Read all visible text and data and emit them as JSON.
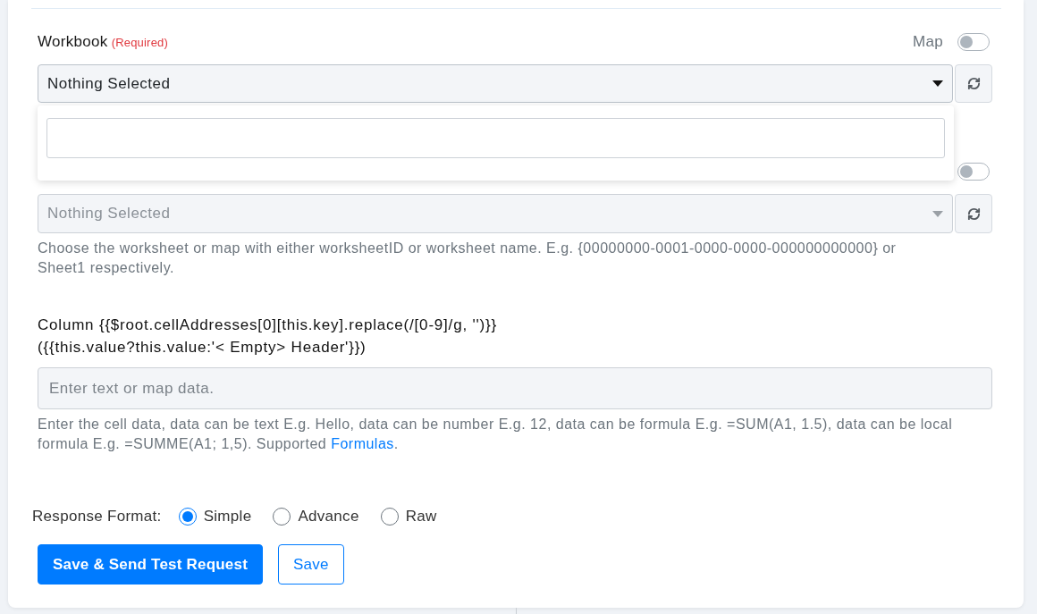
{
  "form": {
    "fields": [
      {
        "kind": "select",
        "label": "Workbook",
        "required_note": "(Required)",
        "map_label": "Map",
        "map_on": false,
        "value": "Nothing Selected",
        "disabled": false,
        "expanded": true
      },
      {
        "kind": "select",
        "map_on": false,
        "value": "Nothing Selected",
        "disabled": true,
        "expanded": false,
        "help": [
          {
            "kind": "text",
            "text": "Choose the worksheet or map with either worksheetID or worksheet name. E.g. {00000000-0001-0000-0000-000000000000} or Sheet1 respectively."
          }
        ]
      },
      {
        "kind": "text",
        "label_lines": [
          "Column {{$root.cellAddresses[0][this.key].replace(/[0-9]/g, '')}}",
          "({{this.value?this.value:'< Empty> Header'}})"
        ],
        "placeholder": "Enter text or map data.",
        "help": [
          {
            "kind": "text",
            "text": "Enter the cell data, data can be text E.g. Hello, data can be number E.g. 12, data can be formula E.g. =SUM(A1, 1.5), data can be local formula E.g. =SUMME(A1; 1,5). Supported "
          },
          {
            "kind": "link",
            "text": "Formulas"
          },
          {
            "kind": "text",
            "text": "."
          }
        ]
      }
    ]
  },
  "response_format": {
    "label": "Response Format:",
    "options": [
      {
        "label": "Simple",
        "selected": true
      },
      {
        "label": "Advance",
        "selected": false
      },
      {
        "label": "Raw",
        "selected": false
      }
    ]
  },
  "buttons": [
    {
      "kind": "primary",
      "label": "Save & Send Test Request"
    },
    {
      "kind": "outline",
      "label": "Save"
    }
  ]
}
